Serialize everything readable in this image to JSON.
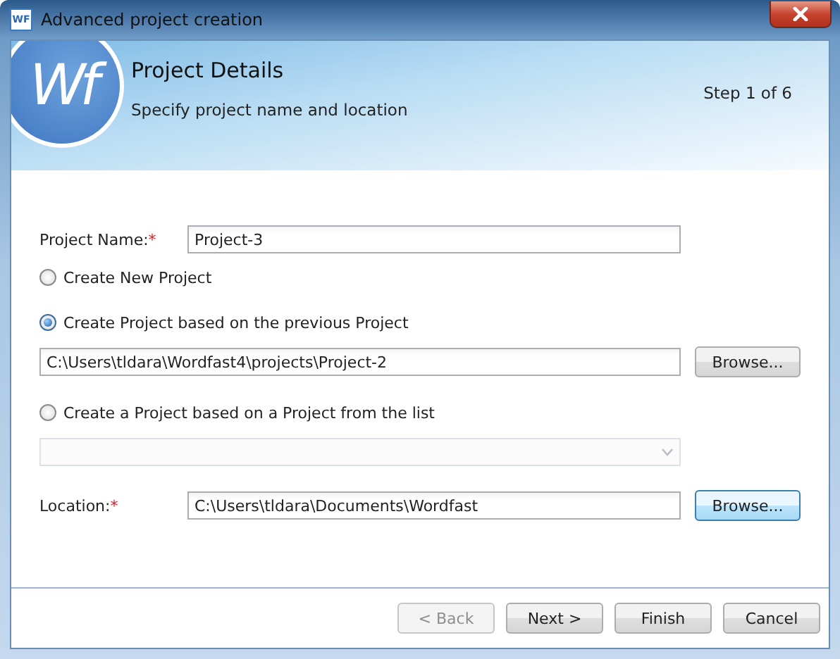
{
  "window": {
    "icon_text": "WF",
    "title": "Advanced project creation"
  },
  "header": {
    "logo_text": "Wf",
    "title": "Project Details",
    "subtitle": "Specify project name and location",
    "step": "Step 1 of 6"
  },
  "form": [
    {
      "kind": "labeled_field",
      "label": "Project Name:",
      "required_mark": "*",
      "value": "Project-3"
    },
    {
      "kind": "radio",
      "label": "Create New Project",
      "selected": false
    },
    {
      "kind": "radio",
      "label": "Create Project based on the previous Project",
      "selected": true
    },
    {
      "kind": "path_field",
      "value": "C:\\Users\\tldara\\Wordfast4\\projects\\Project-2",
      "button": {
        "label": "Browse...",
        "focused": false
      }
    },
    {
      "kind": "radio",
      "label": "Create a Project based on a Project from the list",
      "selected": false
    },
    {
      "kind": "dropdown",
      "disabled": true
    },
    {
      "kind": "labeled_field",
      "label": "Location:",
      "required_mark": "*",
      "value": "C:\\Users\\tldara\\Documents\\Wordfast",
      "button": {
        "label": "Browse...",
        "focused": true
      }
    }
  ],
  "footer_buttons": [
    {
      "label": "< Back",
      "disabled": true
    },
    {
      "label": "Next >",
      "disabled": false
    },
    {
      "label": "Finish",
      "disabled": false
    },
    {
      "label": "Cancel",
      "disabled": false
    }
  ]
}
